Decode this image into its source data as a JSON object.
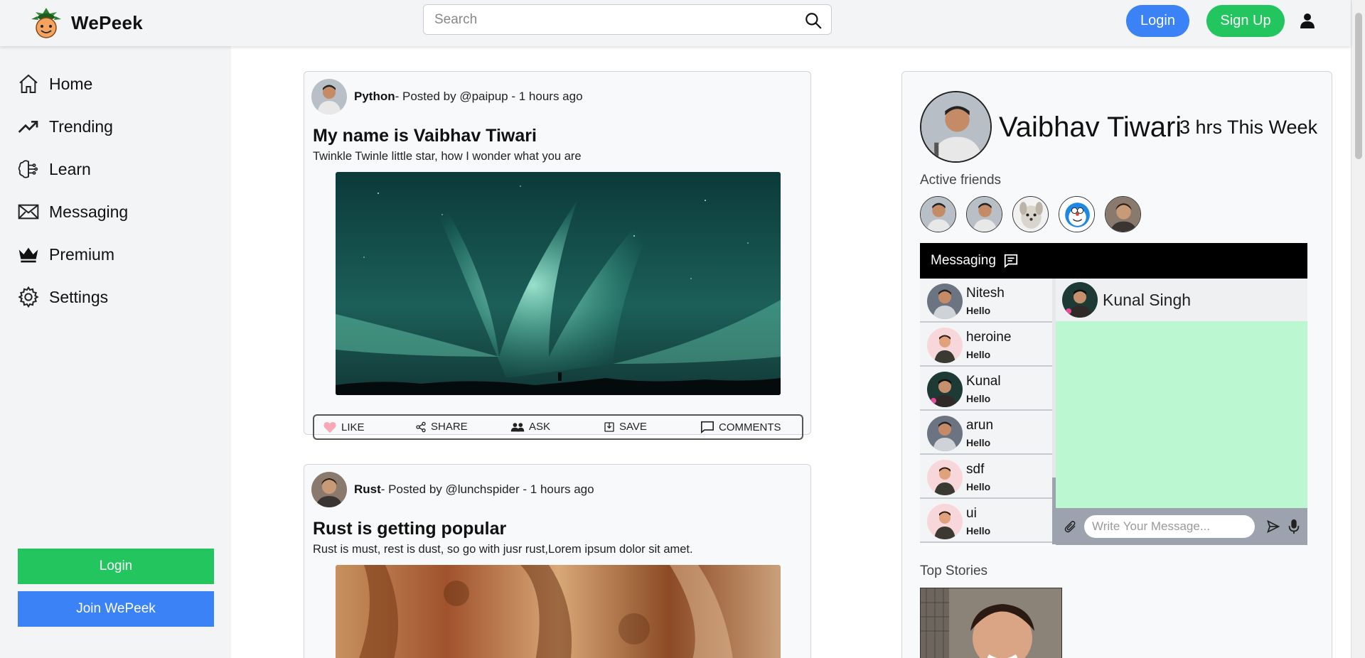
{
  "header": {
    "logo_text": "WePeek",
    "search_placeholder": "Search",
    "login_label": "Login",
    "signup_label": "Sign Up"
  },
  "sidebar": {
    "items": [
      {
        "label": "Home",
        "icon": "home-icon"
      },
      {
        "label": "Trending",
        "icon": "trending-icon"
      },
      {
        "label": "Learn",
        "icon": "brain-icon"
      },
      {
        "label": "Messaging",
        "icon": "mail-icon"
      },
      {
        "label": "Premium",
        "icon": "crown-icon"
      },
      {
        "label": "Settings",
        "icon": "gear-icon"
      }
    ],
    "login_label": "Login",
    "join_label": "Join WePeek"
  },
  "posts": [
    {
      "topic": "Python",
      "meta": "- Posted by @paipup - 1 hours ago",
      "title": "My name is Vaibhav Tiwari",
      "desc": "Twinkle Twinle little star, how I wonder what you are",
      "actions": {
        "like": "LIKE",
        "share": "SHARE",
        "ask": "ASK",
        "save": "SAVE",
        "comments": "COMMENTS"
      }
    },
    {
      "topic": "Rust",
      "meta": "- Posted by @lunchspider - 1 hours ago",
      "title": "Rust is getting popular",
      "desc": "Rust is must, rest is dust, so go with jusr rust,Lorem ipsum dolor sit amet."
    }
  ],
  "profile": {
    "name": "Vaibhav Tiwari",
    "time": "3 hrs This Week",
    "active_label": "Active friends"
  },
  "messaging": {
    "title": "Messaging",
    "contacts": [
      {
        "name": "Nitesh",
        "msg": "Hello"
      },
      {
        "name": "heroine",
        "msg": "Hello"
      },
      {
        "name": "Kunal",
        "msg": "Hello"
      },
      {
        "name": "arun",
        "msg": "Hello"
      },
      {
        "name": "sdf",
        "msg": "Hello"
      },
      {
        "name": "ui",
        "msg": "Hello"
      }
    ],
    "active_chat": "Kunal Singh",
    "input_placeholder": "Write Your Message..."
  },
  "top_stories_label": "Top Stories",
  "colors": {
    "primary": "#3b82f6",
    "success": "#22c55e",
    "chat_bg": "#bbf7d0"
  }
}
